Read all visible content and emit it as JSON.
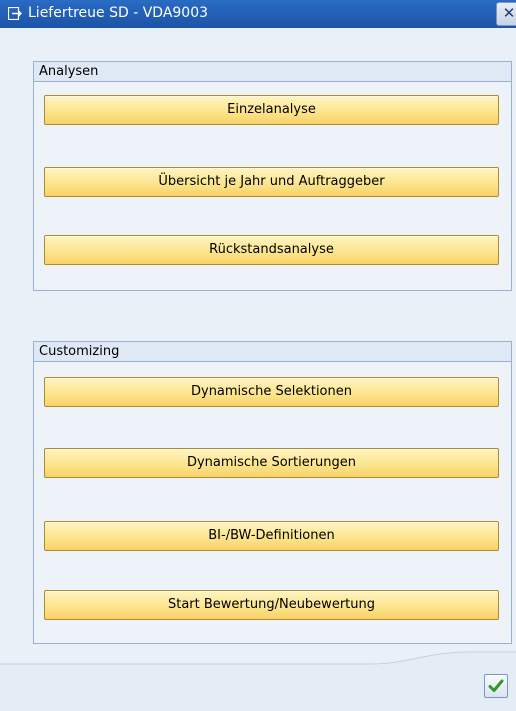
{
  "window": {
    "title": "Liefertreue SD - VDA9003",
    "close_label": "✕"
  },
  "analysen": {
    "header": "Analysen",
    "buttons": [
      "Einzelanalyse",
      "Übersicht je Jahr und Auftraggeber",
      "Rückstandsanalyse"
    ]
  },
  "customizing": {
    "header": "Customizing",
    "buttons": [
      "Dynamische Selektionen",
      "Dynamische Sortierungen",
      "BI-/BW-Definitionen",
      "Start Bewertung/Neubewertung"
    ]
  },
  "icons": {
    "title": "exit-window-icon",
    "ok": "checkmark-icon"
  },
  "colors": {
    "titlebar": "#1c54a8",
    "button": "#fde58e",
    "group_border": "#9ab0cd",
    "ok_check": "#2f9a1f"
  }
}
